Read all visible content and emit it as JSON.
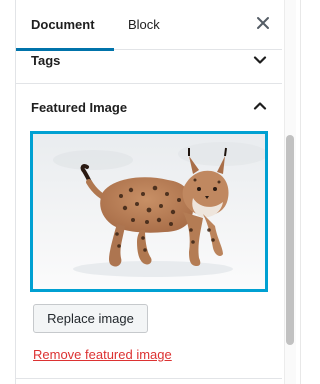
{
  "tabs": {
    "document": "Document",
    "block": "Block",
    "close_glyph": "×"
  },
  "sections": {
    "tags": {
      "title": "Tags",
      "state": "collapsed"
    },
    "featured_image": {
      "title": "Featured Image",
      "state": "expanded",
      "replace_label": "Replace image",
      "remove_label": "Remove featured image"
    }
  },
  "colors": {
    "accent": "#0073aa",
    "image_border": "#00a0d2",
    "danger": "#dc3232"
  },
  "icons": {
    "close": "close-icon",
    "tags_toggle": "chevron-down-icon",
    "featured_toggle": "chevron-up-icon"
  }
}
